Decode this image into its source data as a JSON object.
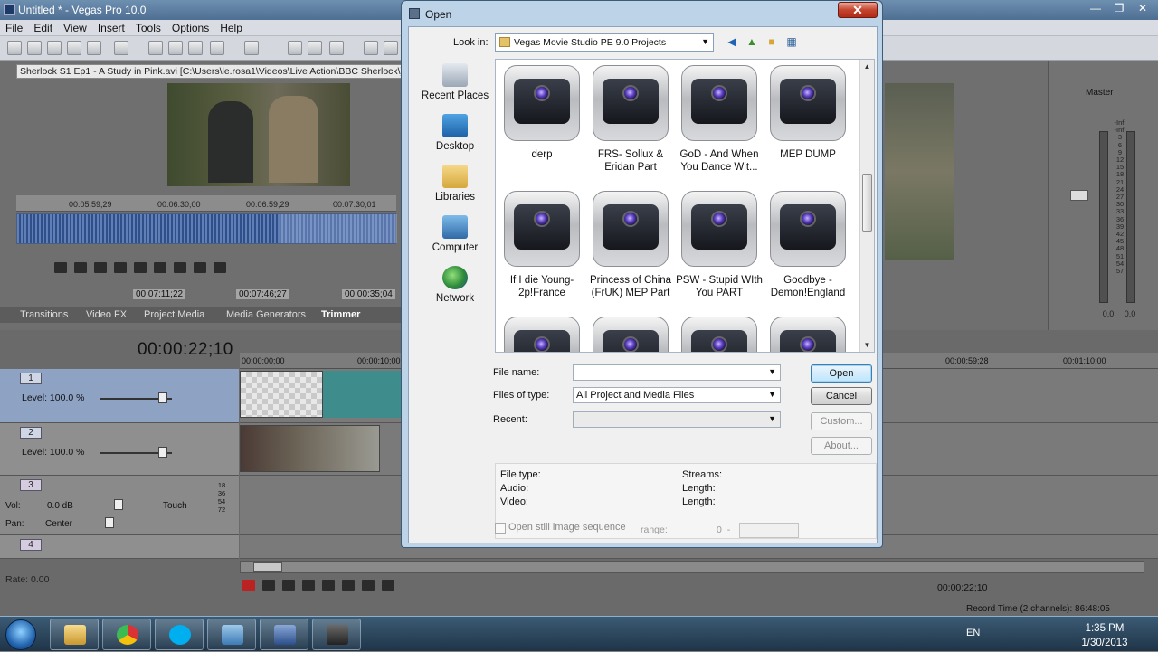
{
  "app": {
    "title": "Untitled * - Vegas Pro 10.0",
    "window_buttons": [
      "—",
      "❐",
      "✕"
    ],
    "menu": [
      "File",
      "Edit",
      "View",
      "Insert",
      "Tools",
      "Options",
      "Help"
    ]
  },
  "trimmer": {
    "info": "Sherlock S1 Ep1 - A Study in Pink.avi    [C:\\Users\\le.rosa1\\Videos\\Live Action\\BBC Sherlock\\]",
    "ruler": [
      "00:05:59;29",
      "00:06:30;00",
      "00:06:59;29",
      "00:07:30;01"
    ],
    "times": [
      "00:07:11;22",
      "00:07:46;27",
      "00:00:35;04"
    ],
    "tabs": [
      "Transitions",
      "Video FX",
      "Project Media",
      "Media Generators",
      "Trimmer"
    ]
  },
  "master": {
    "label": "Master",
    "scale": [
      "-Inf.",
      "-Inf.",
      "3",
      "6",
      "9",
      "12",
      "15",
      "18",
      "21",
      "24",
      "27",
      "30",
      "33",
      "36",
      "39",
      "42",
      "45",
      "48",
      "51",
      "54",
      "57"
    ],
    "values": [
      "0.0",
      "0.0"
    ]
  },
  "timeline": {
    "time": "00:00:22;10",
    "ruler": [
      "00:00:00;00",
      "00:00:10;00",
      "00:00:59;28",
      "00:01:10;00"
    ],
    "tracks": [
      {
        "num": "1",
        "level": "Level: 100.0 %"
      },
      {
        "num": "2",
        "level": "Level: 100.0 %"
      },
      {
        "num": "3",
        "vol_label": "Vol:",
        "vol_value": "0.0 dB",
        "touch": "Touch",
        "pan_label": "Pan:",
        "pan_value": "Center"
      },
      {
        "num": "4"
      }
    ],
    "meter_mini": [
      "18",
      "36",
      "54",
      "72"
    ],
    "rate": "Rate: 0.00",
    "tc": "00:00:22;10",
    "record_time": "Record Time (2 channels): 86:48:05"
  },
  "dialog": {
    "title": "Open",
    "close_glyph": "✕",
    "look_in_label": "Look in:",
    "look_in_value": "Vegas Movie Studio PE 9.0 Projects",
    "places": [
      "Recent Places",
      "Desktop",
      "Libraries",
      "Computer",
      "Network"
    ],
    "files": [
      [
        "derp"
      ],
      [
        "FRS- Sollux &",
        "Eridan Part"
      ],
      [
        "GoD - And When",
        "You Dance Wit..."
      ],
      [
        "MEP DUMP"
      ],
      [
        "If I die Young-",
        "2p!France"
      ],
      [
        "Princess of China",
        "(FrUK) MEP Part"
      ],
      [
        "PSW - Stupid WIth",
        "You PART"
      ],
      [
        "Goodbye -",
        "Demon!England"
      ],
      [
        ""
      ],
      [
        ""
      ],
      [
        ""
      ],
      [
        ""
      ]
    ],
    "file_name_label": "File name:",
    "file_name_value": "",
    "files_of_type_label": "Files of type:",
    "files_of_type_value": "All Project and Media Files",
    "recent_label": "Recent:",
    "recent_value": "",
    "buttons": {
      "open": "Open",
      "cancel": "Cancel",
      "custom": "Custom...",
      "about": "About..."
    },
    "info": {
      "file_type": "File type:",
      "audio": "Audio:",
      "video": "Video:",
      "streams": "Streams:",
      "length1": "Length:",
      "length2": "Length:"
    },
    "still_sequence": "Open still image sequence",
    "range_label": "range:",
    "range_from": "0",
    "range_dash": "-",
    "range_to": ""
  },
  "taskbar": {
    "lang": "EN",
    "time": "1:35 PM",
    "date": "1/30/2013",
    "apps": [
      "file-explorer",
      "chrome",
      "skype",
      "network-window",
      "vegas-floppy",
      "vegas-pro"
    ]
  }
}
